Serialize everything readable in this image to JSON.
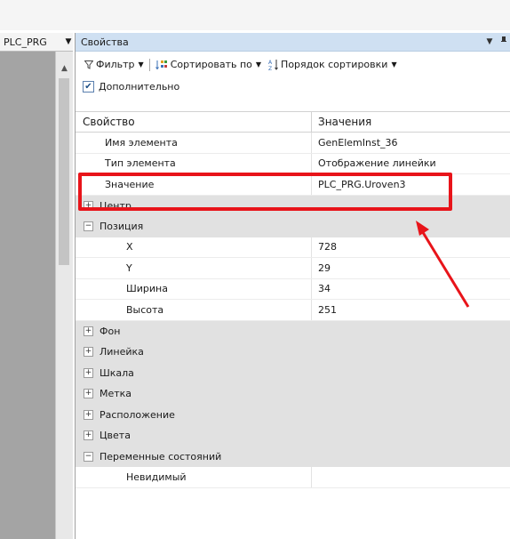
{
  "left_combo": {
    "value": "PLC_PRG"
  },
  "panel": {
    "title": "Свойства",
    "toolbar": {
      "filter_label": "Фильтр",
      "sort_by_label": "Сортировать по",
      "sort_order_label": "Порядок сортировки"
    },
    "extra_checkbox": {
      "label": "Дополнительно",
      "checked": true
    },
    "columns": {
      "property": "Свойство",
      "value": "Значения"
    },
    "rows": [
      {
        "type": "prop",
        "indent": 1,
        "name": "Имя элемента",
        "value": "GenElemInst_36"
      },
      {
        "type": "prop",
        "indent": 1,
        "name": "Тип элемента",
        "value": "Отображение линейки"
      },
      {
        "type": "prop",
        "indent": 1,
        "name": "Значение",
        "value": "PLC_PRG.Uroven3"
      },
      {
        "type": "group",
        "expanded": false,
        "name": "Центр",
        "value": ""
      },
      {
        "type": "group",
        "expanded": true,
        "name": "Позиция",
        "value": ""
      },
      {
        "type": "prop",
        "indent": 2,
        "name": "X",
        "value": "728"
      },
      {
        "type": "prop",
        "indent": 2,
        "name": "Y",
        "value": "29"
      },
      {
        "type": "prop",
        "indent": 2,
        "name": "Ширина",
        "value": "34"
      },
      {
        "type": "prop",
        "indent": 2,
        "name": "Высота",
        "value": "251"
      },
      {
        "type": "group",
        "expanded": false,
        "name": "Фон",
        "value": ""
      },
      {
        "type": "group",
        "expanded": false,
        "name": "Линейка",
        "value": ""
      },
      {
        "type": "group",
        "expanded": false,
        "name": "Шкала",
        "value": ""
      },
      {
        "type": "group",
        "expanded": false,
        "name": "Метка",
        "value": ""
      },
      {
        "type": "group",
        "expanded": false,
        "name": "Расположение",
        "value": ""
      },
      {
        "type": "group",
        "expanded": false,
        "name": "Цвета",
        "value": ""
      },
      {
        "type": "group",
        "expanded": true,
        "name": "Переменные состояний",
        "value": ""
      },
      {
        "type": "prop",
        "indent": 2,
        "name": "Невидимый",
        "value": ""
      }
    ]
  },
  "colors": {
    "title_bar": "#cfe0f2",
    "group_row": "#e1e1e1",
    "annotation": "#e8141a"
  },
  "icons": {
    "dropdown": "chevron-down-icon",
    "pin": "pin-icon",
    "filter": "filter-icon",
    "sort": "sort-icon",
    "sort_order": "sort-az-icon"
  }
}
